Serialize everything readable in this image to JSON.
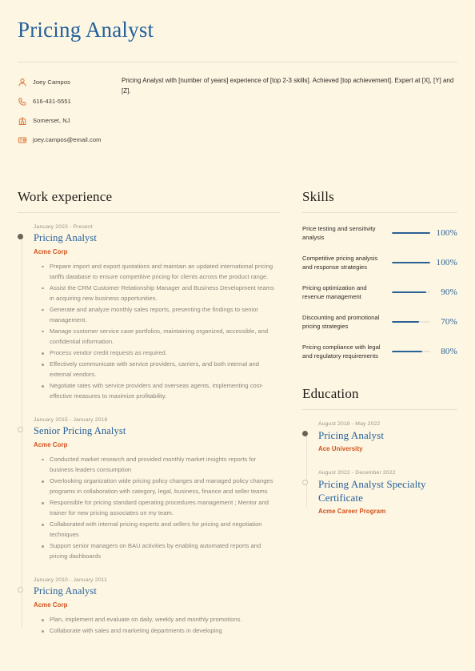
{
  "header": {
    "name": "Pricing Analyst",
    "contacts": [
      {
        "icon": "person-icon",
        "text": "Joey Campos"
      },
      {
        "icon": "phone-icon",
        "text": "616-431-5551"
      },
      {
        "icon": "location-icon",
        "text": "Somerset, NJ"
      },
      {
        "icon": "email-icon",
        "text": "joey.campos@email.com"
      }
    ],
    "summary": "Pricing Analyst with [number of years] experience of [top 2-3 skills]. Achieved [top achievement]. Expert at [X], [Y] and [Z]."
  },
  "work": {
    "title": "Work experience",
    "entries": [
      {
        "date": "January 2023 - Present",
        "role": "Pricing Analyst",
        "org": "Acme Corp",
        "marker": "filled",
        "bullets": [
          "Prepare import and export quotations and maintain an updated international pricing tariffs database to ensure competitive pricing for clients across the product range.",
          "Assist the CRM Customer Relationship Manager and Business Development teams in acquiring new business opportunities.",
          "Generate and analyze monthly sales reports, presenting the findings to senior management.",
          "Manage customer service case portfolios, maintaining organized, accessible, and confidential information.",
          "Process vendor credit requests as required.",
          "Effectively communicate with service providers, carriers, and both internal and external vendors.",
          "Negotiate rates with service providers and overseas agents, implementing cost-effective measures to maximize profitability."
        ]
      },
      {
        "date": "January 2015 - January 2016",
        "role": "Senior Pricing Analyst",
        "org": "Acme Corp",
        "marker": "hollow",
        "bullets": [
          "Conducted market research and provided monthly market insights reports for business leaders consumption",
          "Overlooking organization wide pricing policy changes and managed policy changes programs in collaboration with category, legal, business, finance and seller teams",
          "Responsible for pricing standard operating procedures management ; Mentor and trainer for new pricing associates on my team.",
          "Collaborated with internal pricing experts and sellers for pricing and negotiation techniques",
          "Support senior managers on BAU activities by enabling automated reports and pricing dashboards"
        ]
      },
      {
        "date": "January 2010 - January 2011",
        "role": "Pricing Analyst",
        "org": "Acme Corp",
        "marker": "hollow",
        "bullets": [
          "Plan, implement and evaluate on daily, weekly and monthly promotions.",
          "Collaborate with sales and marketing departments in developing"
        ]
      }
    ]
  },
  "skills": {
    "title": "Skills",
    "items": [
      {
        "name": "Price testing and sensitivity analysis",
        "percent": 100,
        "label": "100%"
      },
      {
        "name": "Competitive pricing analysis and response strategies",
        "percent": 100,
        "label": "100%"
      },
      {
        "name": "Pricing optimization and revenue management",
        "percent": 90,
        "label": "90%"
      },
      {
        "name": "Discounting and promotional pricing strategies",
        "percent": 70,
        "label": "70%"
      },
      {
        "name": "Pricing compliance with legal and regulatory requirements",
        "percent": 80,
        "label": "80%"
      }
    ]
  },
  "education": {
    "title": "Education",
    "entries": [
      {
        "date": "August 2018 - May 2022",
        "degree": "Pricing Analyst",
        "school": "Ace University",
        "marker": "filled"
      },
      {
        "date": "August 2022 - December 2022",
        "degree": "Pricing Analyst Specialty Certificate",
        "school": "Acme Career Program",
        "marker": "hollow"
      }
    ]
  },
  "colors": {
    "background": "#fdf6e3",
    "heading_blue": "#24609b",
    "accent_orange": "#d0521c",
    "icon_orange": "#d9702f",
    "body_text": "#8d857a",
    "bar_fill": "#2a6296"
  }
}
